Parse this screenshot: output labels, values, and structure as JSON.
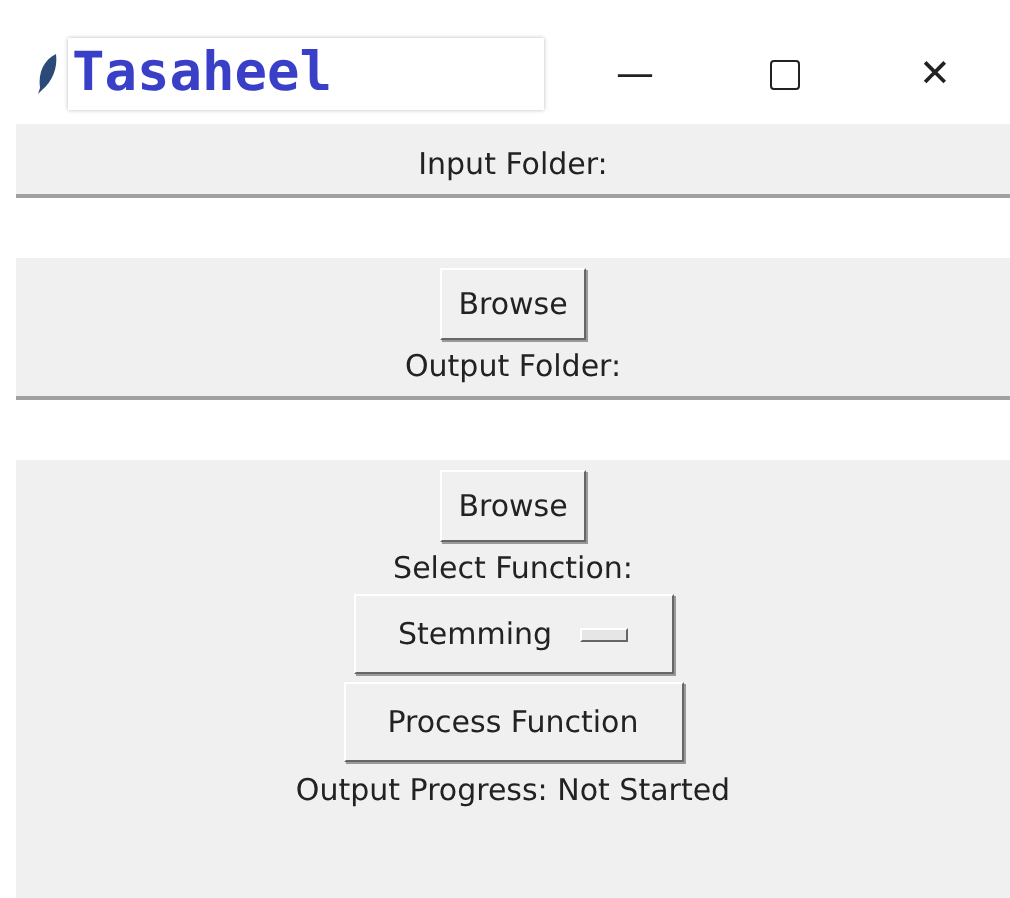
{
  "window": {
    "title": "Tasaheel",
    "controls": [
      {
        "kind": "minimize",
        "label": "—"
      },
      {
        "kind": "maximize"
      },
      {
        "kind": "close",
        "label": "✕"
      }
    ]
  },
  "input_folder": {
    "label": "Input Folder:",
    "button": "Browse"
  },
  "output_folder": {
    "label": "Output Folder:",
    "button": "Browse"
  },
  "function": {
    "label": "Select Function:",
    "value": "Stemming"
  },
  "process_button": "Process Function",
  "status": "Output Progress: Not Started"
}
